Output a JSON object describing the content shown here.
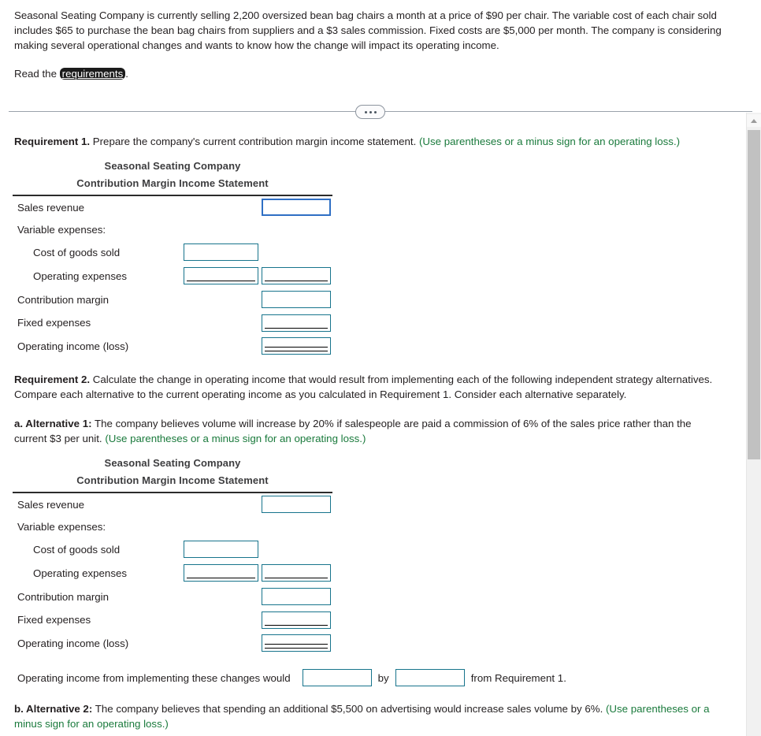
{
  "problem": {
    "paragraph": "Seasonal Seating Company is currently selling 2,200 oversized bean bag chairs a month at a price of $90 per chair. The variable cost of each chair sold includes $65 to purchase the bean bag chairs from suppliers and a $3 sales commission. Fixed costs are $5,000 per month. The company is considering making several operational changes and wants to know how the change will impact its operating income.",
    "read_prefix": "Read the ",
    "read_link": "requirements",
    "read_suffix": "."
  },
  "divider": {
    "ellipsis_label": "..."
  },
  "requirement1": {
    "label": "Requirement 1.",
    "text": " Prepare the company's current contribution margin income statement. ",
    "hint": "(Use parentheses or a minus sign for an operating loss.)"
  },
  "requirement2": {
    "label": "Requirement 2.",
    "text": " Calculate the change in operating income that would result from implementing each of the following independent strategy alternatives. Compare each alternative to the current operating income as you calculated in Requirement 1. Consider each alternative separately."
  },
  "alternative_a": {
    "label": "a. Alternative 1:",
    "text": " The company believes volume will increase by 20% if salespeople are paid a commission of 6% of the sales price rather than the current $3 per unit. ",
    "hint": "(Use parentheses or a minus sign for an operating loss.)"
  },
  "alternative_b": {
    "label": "b. Alternative 2:",
    "text": " The company believes that spending an additional $5,500 on advertising would increase sales volume by 6%. ",
    "hint": "(Use parentheses or a minus sign for an operating loss.)"
  },
  "statement": {
    "company": "Seasonal Seating Company",
    "title": "Contribution Margin Income Statement",
    "rows": {
      "sales_revenue": "Sales revenue",
      "variable_expenses": "Variable expenses:",
      "cost_of_goods_sold": "Cost of goods sold",
      "operating_expenses": "Operating expenses",
      "contribution_margin": "Contribution margin",
      "fixed_expenses": "Fixed expenses",
      "operating_income": "Operating income (loss)"
    }
  },
  "sentence": {
    "prefix": "Operating income from implementing these changes would",
    "middle": "by",
    "suffix": "from Requirement 1.",
    "field1_value": "",
    "field2_value": ""
  },
  "colors": {
    "input_border": "#17748c",
    "focused_border": "#2f6fc4",
    "hint_green": "#1a7a3c",
    "text": "#231f20",
    "title_gray": "#3d3d3f"
  },
  "scrollbar": {
    "up_arrow": "scroll-up"
  }
}
